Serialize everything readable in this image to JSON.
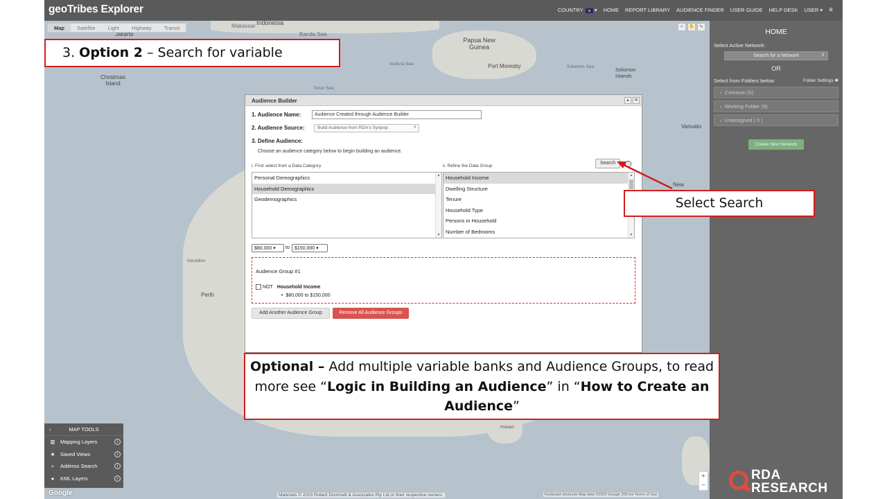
{
  "app": {
    "brand": "geoTribes Explorer",
    "nav": [
      "COUNTRY",
      "HOME",
      "REPORT LIBRARY",
      "AUDIENCE FINDER",
      "USER GUIDE",
      "HELP DESK",
      "USER"
    ]
  },
  "map": {
    "types": [
      "Map",
      "Satellite",
      "Light",
      "Highway",
      "Transit"
    ],
    "selected_type": "Map",
    "labels": [
      "Indonesia",
      "Jakarta",
      "Makassar",
      "Banda Sea",
      "Papua New Guinea",
      "Port Moresby",
      "Arafura Sea",
      "Solomon Sea",
      "Solomon Islands",
      "Christmas Island",
      "Timor Sea",
      "Vanuatu",
      "New",
      "Geraldton",
      "Perth",
      "Hobart"
    ],
    "copyright": "Materials © 2023 Robert Dommett & Associates Pty Ltd or their respective owners.",
    "scale_text": "Keyboard shortcuts   Map data ©2023 Google   200 km   Terms of Use",
    "google": "Google",
    "zoom_in": "+",
    "zoom_out": "−"
  },
  "right_panel": {
    "title": "HOME",
    "select_network_label": "Select Active Network:",
    "search_network_placeholder": "Search for a Network",
    "or_text": "OR",
    "folders_label": "Select from Folders below:",
    "folder_settings": "Folder Settings",
    "folders": [
      "Common (5)",
      "Working Folder (9)",
      "Unassigned ( 0 )"
    ],
    "create_button": "Create New Network"
  },
  "map_tools": {
    "title": "MAP TOOLS",
    "items": [
      "Mapping Layers",
      "Saved Views",
      "Address Search",
      "KML Layers"
    ]
  },
  "dialog": {
    "title": "Audience Builder",
    "name_label": "1. Audience Name:",
    "name_value": "Audience Created through Audience Builder",
    "source_label": "2. Audience Source:",
    "source_value": "Build Audience from RDA's Synpop",
    "define_label": "3. Define Audience:",
    "define_hint": "Choose an audience category below to begin building an audience.",
    "category_label": "i. First select from a Data Category",
    "group_label": "ii. Refine the Data Group",
    "search_button": "Search",
    "categories": [
      "Personal Demographics",
      "Household Demographics",
      "Geodemographics"
    ],
    "selected_category": "Household Demographics",
    "groups": [
      "Household Income",
      "Dwelling Structure",
      "Tenure",
      "Household Type",
      "Persons in Household",
      "Number of Bedrooms"
    ],
    "selected_group": "Household Income",
    "range_from": "$80,000",
    "range_to_word": "to",
    "range_to": "$150,000",
    "audience_group": {
      "title": "Audience Group #1",
      "not_label": "NOT",
      "variable": "Household Income",
      "value": "$80,000 to $150,000"
    },
    "add_button": "Add Another Audience Group",
    "remove_button": "Remove All Audience Groups"
  },
  "callouts": {
    "option_prefix": "3. ",
    "option_bold": "Option 2",
    "option_rest": " – Search for variable",
    "select_search": "Select Search",
    "optional_bold": "Optional –",
    "optional_text1": " Add multiple variable banks and Audience Groups, to read more see “",
    "optional_bold2": "Logic in Building an Audience",
    "optional_text2": "” in “",
    "optional_bold3": "How to Create an Audience",
    "optional_text3": "”"
  },
  "logo": {
    "line1": "RDA",
    "line2": "RESEARCH"
  },
  "colors": {
    "callout_border": "#d21d1d",
    "remove_button": "#d9534f",
    "create_button": "#7fb07f"
  }
}
